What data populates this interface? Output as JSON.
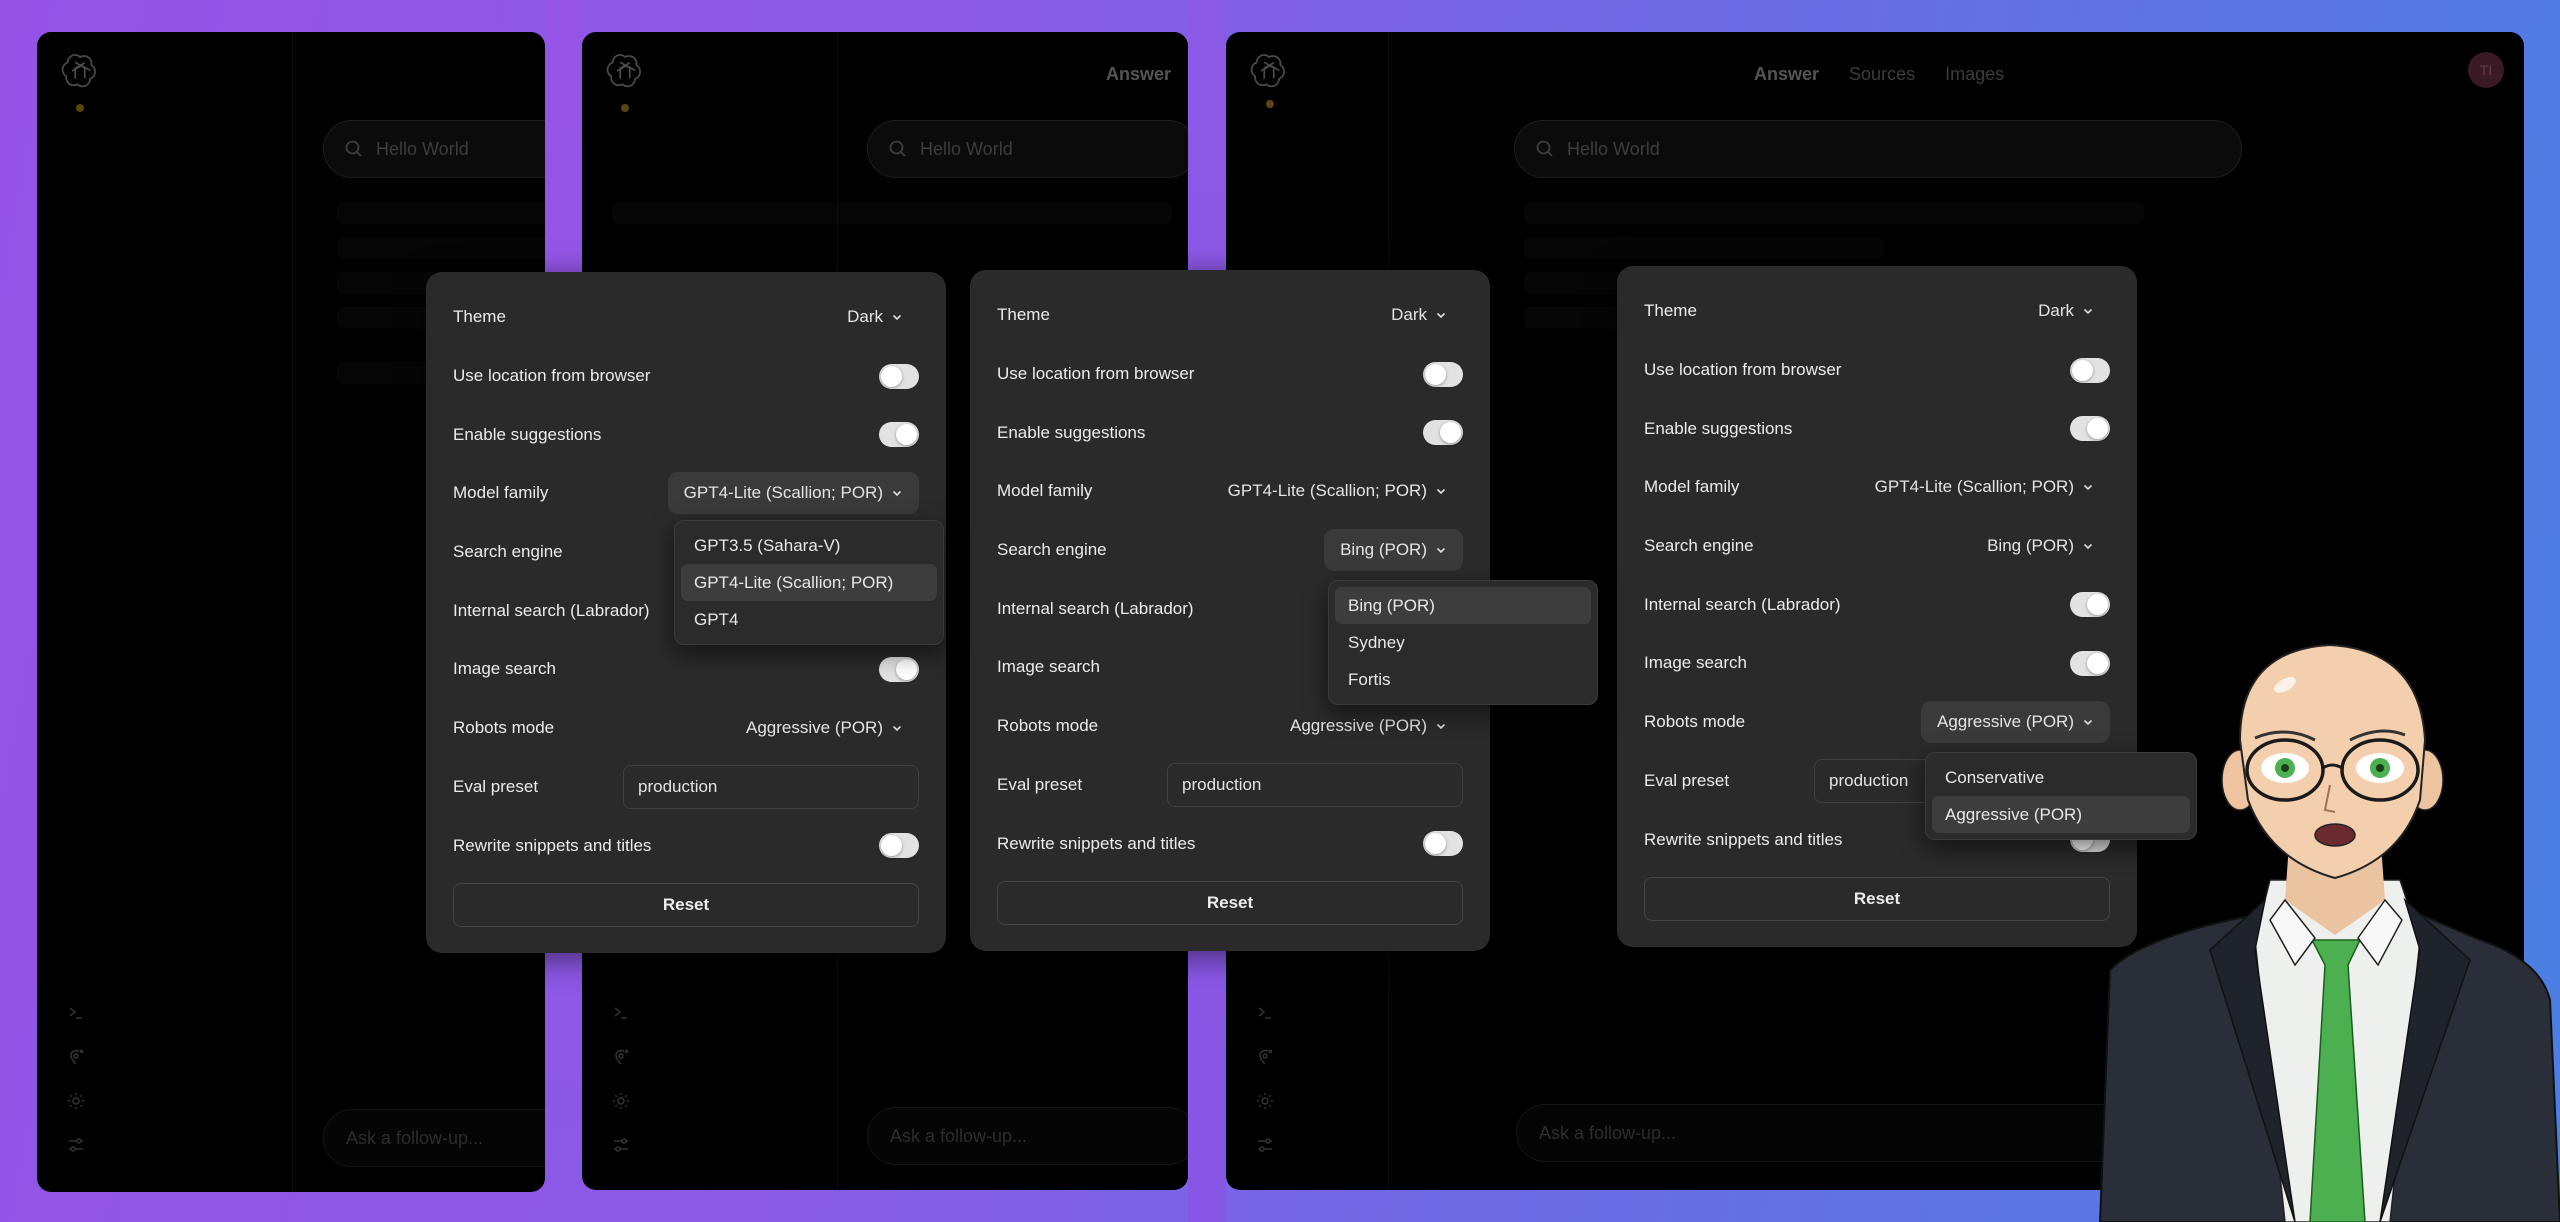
{
  "app": {
    "search_query": "Hello World",
    "follow_up_placeholder": "Ask a follow-up...",
    "tabs": [
      {
        "label": "Answer",
        "active": true
      },
      {
        "label": "Sources",
        "active": false
      },
      {
        "label": "Images",
        "active": false
      }
    ],
    "avatar_initials": "TI",
    "sidebar_icons": [
      "terminal-icon",
      "location-off-icon",
      "sun-icon",
      "sliders-icon"
    ]
  },
  "settings_labels": {
    "theme": "Theme",
    "use_location": "Use location from browser",
    "enable_suggestions": "Enable suggestions",
    "model_family": "Model family",
    "search_engine": "Search engine",
    "internal_search": "Internal search (Labrador)",
    "image_search": "Image search",
    "robots_mode": "Robots mode",
    "eval_preset": "Eval preset",
    "rewrite_snippets": "Rewrite snippets and titles",
    "reset": "Reset"
  },
  "settings_values": {
    "theme": "Dark",
    "use_location": false,
    "enable_suggestions": true,
    "model_family": "GPT4-Lite (Scallion; POR)",
    "search_engine": "Bing (POR)",
    "internal_search": true,
    "image_search": true,
    "robots_mode": "Aggressive (POR)",
    "eval_preset": "production",
    "rewrite_snippets": false
  },
  "menus": {
    "model_family_options": [
      {
        "label": "GPT3.5 (Sahara-V)",
        "selected": false
      },
      {
        "label": "GPT4-Lite (Scallion; POR)",
        "selected": true
      },
      {
        "label": "GPT4",
        "selected": false
      }
    ],
    "search_engine_options": [
      {
        "label": "Bing (POR)",
        "selected": true
      },
      {
        "label": "Sydney",
        "selected": false
      },
      {
        "label": "Fortis",
        "selected": false
      }
    ],
    "robots_mode_options": [
      {
        "label": "Conservative",
        "selected": false
      },
      {
        "label": "Aggressive (POR)",
        "selected": true
      }
    ]
  },
  "colors": {
    "panel_bg": "#2a2a2a",
    "window_bg": "#000000",
    "toggle_track": "#e2e2e2",
    "gradient_start": "#9553e6",
    "gradient_end": "#4b7fe4"
  }
}
